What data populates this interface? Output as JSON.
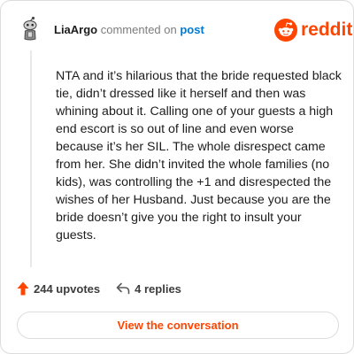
{
  "header": {
    "username": "LiaArgo",
    "commented_text": " commented on ",
    "post_link": "post",
    "avatar_icon": "snoo-avatar-icon"
  },
  "brand": {
    "logo_icon": "reddit-snoo-logo-icon",
    "logo_text": "reddit",
    "color": "#ff4500"
  },
  "comment": {
    "body": "NTA and it’s hilarious that the bride requested black tie, didn’t dressed like it herself and then was whining about it. Calling one of your guests a high end escort is so out of line and even worse because it’s her SIL. The whole disrespect came from her. She didn’t invited the whole families (no kids), was controlling the +1 and disrespected the wishes of her Husband. Just because you are the bride doesn’t give you the right to insult your guests."
  },
  "actions": {
    "upvotes_label": "244 upvotes",
    "upvote_icon": "upvote-arrow-icon",
    "replies_label": "4 replies",
    "reply_icon": "reply-arrow-icon"
  },
  "footer": {
    "view_conversation_label": "View the conversation"
  }
}
